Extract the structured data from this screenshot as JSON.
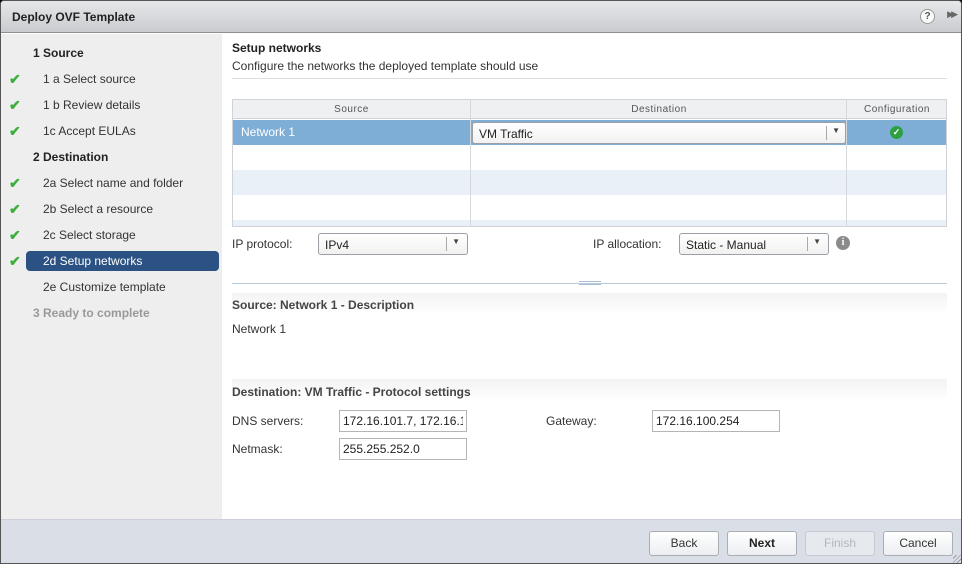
{
  "window": {
    "title": "Deploy OVF Template",
    "icons": [
      "help-icon",
      "expand-icon"
    ],
    "help_glyph": "?",
    "expand_glyph": "▶▶"
  },
  "sidebar": {
    "steps": [
      {
        "label": "1  Source",
        "type": "group",
        "completed": false,
        "state": "normal"
      },
      {
        "label": "1 a  Select source",
        "type": "sub",
        "completed": true,
        "state": "normal"
      },
      {
        "label": "1 b  Review details",
        "type": "sub",
        "completed": true,
        "state": "normal"
      },
      {
        "label": "1c  Accept EULAs",
        "type": "sub",
        "completed": true,
        "state": "normal"
      },
      {
        "label": "2  Destination",
        "type": "group",
        "completed": false,
        "state": "normal"
      },
      {
        "label": "2a  Select name and folder",
        "type": "sub",
        "completed": true,
        "state": "normal"
      },
      {
        "label": "2b  Select a resource",
        "type": "sub",
        "completed": true,
        "state": "normal"
      },
      {
        "label": "2c  Select storage",
        "type": "sub",
        "completed": true,
        "state": "normal"
      },
      {
        "label": "2d  Setup networks",
        "type": "sub",
        "completed": true,
        "state": "active"
      },
      {
        "label": "2e  Customize template",
        "type": "sub",
        "completed": false,
        "state": "normal"
      },
      {
        "label": "3  Ready to complete",
        "type": "group",
        "completed": false,
        "state": "disabled"
      }
    ],
    "check_glyph": "✔"
  },
  "main": {
    "heading": "Setup networks",
    "subheading": "Configure the networks the deployed template should use",
    "table": {
      "columns": [
        "Source",
        "Destination",
        "Configuration"
      ],
      "rows": [
        {
          "source": "Network 1",
          "destination": "VM Traffic",
          "configuration": "ok",
          "selected": true
        }
      ],
      "config_ok_glyph": "✓",
      "dropdown_glyph": "▼"
    },
    "ip_protocol": {
      "label": "IP protocol:",
      "value": "IPv4"
    },
    "ip_allocation": {
      "label": "IP allocation:",
      "value": "Static - Manual"
    },
    "info_glyph": "i",
    "source_section": {
      "title": "Source: Network 1 - Description",
      "text": "Network 1"
    },
    "destination_section": {
      "title": "Destination: VM Traffic - Protocol settings",
      "dns_label": "DNS servers:",
      "dns_value": "172.16.101.7, 172.16.1",
      "gateway_label": "Gateway:",
      "gateway_value": "172.16.100.254",
      "netmask_label": "Netmask:",
      "netmask_value": "255.255.252.0"
    }
  },
  "footer": {
    "back": "Back",
    "next": "Next",
    "finish": "Finish",
    "cancel": "Cancel",
    "finish_enabled": false
  },
  "colors": {
    "active_step": "#2b5283",
    "selected_row": "#7eaed6",
    "check_green": "#3cae3c"
  }
}
